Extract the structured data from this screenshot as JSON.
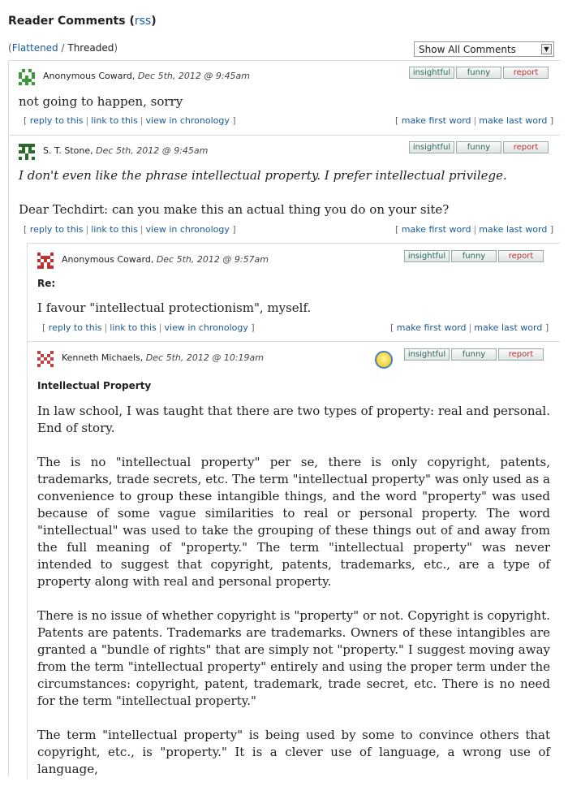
{
  "header": {
    "title": "Reader Comments",
    "rss": "rss"
  },
  "view": {
    "flattened": "Flattened",
    "threaded": "Threaded",
    "select_value": "Show All Comments"
  },
  "buttons": {
    "insightful": "insightful",
    "funny": "funny",
    "report": "report"
  },
  "links": {
    "reply": "reply to this",
    "link": "link to this",
    "chronology": "view in chronology",
    "first_word": "make first word",
    "last_word": "make last word"
  },
  "comments": [
    {
      "author": "Anonymous Coward",
      "date": "Dec 5th, 2012 @ 9:45am",
      "body": [
        "not going to happen, sorry"
      ]
    },
    {
      "author": "S. T. Stone",
      "date": "Dec 5th, 2012 @ 9:45am",
      "body": [
        "I don't even like the phrase intellectual property. I prefer intellectual privilege.",
        "Dear Techdirt: can you make this an actual thing you do on your site?"
      ]
    },
    {
      "author": "Anonymous Coward",
      "date": "Dec 5th, 2012 @ 9:57am",
      "subject": "Re:",
      "body": [
        "I favour \"intellectual protectionism\", myself."
      ]
    },
    {
      "author": "Kenneth Michaels",
      "date": "Dec 5th, 2012 @ 10:19am",
      "subject": "Intellectual Property",
      "body": [
        "In law school, I was taught that there are two types of property: real and personal. End of story.",
        "The is no \"intellectual property\" per se, there is only copyright, patents, trademarks, trade secrets, etc. The term \"intellectual property\" was only used as a convenience to group these intangible things, and the word \"property\" was used because of some vague similarities to real or personal property. The word \"intellectual\" was used to take the grouping of these things out of and away from the full meaning of \"property.\" The term \"intellectual property\" was never intended to suggest that copyright, patents, trademarks, etc., are a type of property along with real and personal property.",
        "There is no issue of whether copyright is \"property\" or not. Copyright is copyright. Patents are patents. Trademarks are trademarks. Owners of these intangibles are granted a \"bundle of rights\" that are simply not \"property.\" I suggest moving away from the term \"intellectual property\" entirely and using the proper term under the circumstances: copyright, patent, trademark, trade secret, etc. There is no need for the term \"intellectual property.\"",
        "The term \"intellectual property\" is being used by some to convince others that copyright, etc., is \"property.\" It is a clever use of language, a wrong use of language,"
      ]
    }
  ],
  "colors": {
    "link": "#1a5a9a",
    "border": "#d4dde6",
    "avatar1": "#3a9a3a",
    "avatar2": "#2a6a2a",
    "avatar3": "#c03030",
    "avatar4": "#c04040"
  }
}
